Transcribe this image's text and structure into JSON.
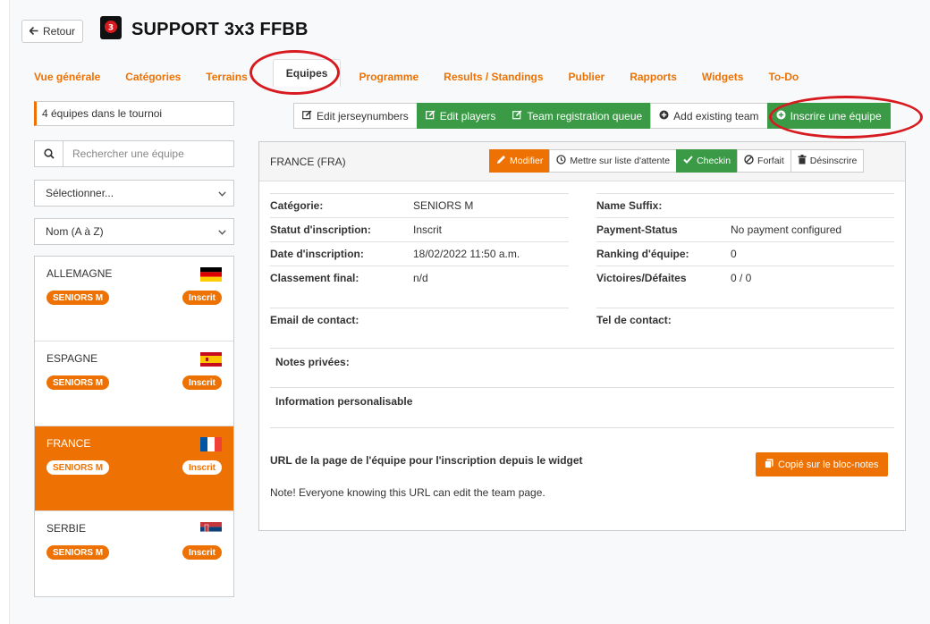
{
  "header": {
    "back_label": "Retour",
    "title": "SUPPORT 3x3 FFBB"
  },
  "tabs": [
    {
      "label": "Vue générale",
      "active": false
    },
    {
      "label": "Catégories",
      "active": false
    },
    {
      "label": "Terrains",
      "active": false
    },
    {
      "label": "Equipes",
      "active": true
    },
    {
      "label": "Programme",
      "active": false
    },
    {
      "label": "Results / Standings",
      "active": false
    },
    {
      "label": "Publier",
      "active": false
    },
    {
      "label": "Rapports",
      "active": false
    },
    {
      "label": "Widgets",
      "active": false
    },
    {
      "label": "To-Do",
      "active": false
    }
  ],
  "sidebar": {
    "count_text": "4 équipes dans le tournoi",
    "search_placeholder": "Rechercher une équipe",
    "filter_select": "Sélectionner...",
    "sort_select": "Nom (A à Z)",
    "teams": [
      {
        "name": "ALLEMAGNE",
        "category": "SENIORS M",
        "status": "Inscrit",
        "flag": "de",
        "active": false
      },
      {
        "name": "ESPAGNE",
        "category": "SENIORS M",
        "status": "Inscrit",
        "flag": "es",
        "active": false
      },
      {
        "name": "FRANCE",
        "category": "SENIORS M",
        "status": "Inscrit",
        "flag": "fr",
        "active": true
      },
      {
        "name": "SERBIE",
        "category": "SENIORS M",
        "status": "Inscrit",
        "flag": "rs",
        "active": false
      }
    ]
  },
  "toolbar": {
    "edit_jersey": "Edit jerseynumbers",
    "edit_players": "Edit players",
    "team_queue": "Team registration queue",
    "add_existing": "Add existing team",
    "register_team": "Inscrire une équipe"
  },
  "panel": {
    "title": "FRANCE (FRA)",
    "actions": {
      "modify": "Modifier",
      "waitlist": "Mettre sur liste d'attente",
      "checkin": "Checkin",
      "forfeit": "Forfait",
      "unregister": "Désinscrire"
    },
    "left_fields": [
      {
        "label": "Catégorie:",
        "value": "SENIORS M"
      },
      {
        "label": "Statut d'inscription:",
        "value": "Inscrit"
      },
      {
        "label": "Date d'inscription:",
        "value": "18/02/2022 11:50 a.m."
      },
      {
        "label": "Classement final:",
        "value": "n/d"
      }
    ],
    "right_fields": [
      {
        "label": "Name Suffix:",
        "value": ""
      },
      {
        "label": "Payment-Status",
        "value": "No payment configured"
      },
      {
        "label": "Ranking d'équipe:",
        "value": "0"
      },
      {
        "label": "Victoires/Défaites",
        "value": "0 / 0"
      }
    ],
    "contact_email_label": "Email de contact:",
    "contact_tel_label": "Tel de contact:",
    "private_notes_label": "Notes privées:",
    "custom_info_label": "Information personalisable",
    "url_label": "URL de la page de l'équipe pour l'inscription depuis le widget",
    "copy_button": "Copié sur le bloc-notes",
    "note": "Note! Everyone knowing this URL can edit the team page."
  },
  "colors": {
    "accent_orange": "#ee7203",
    "action_green": "#3a9a46",
    "highlight_red": "#d71a20"
  }
}
